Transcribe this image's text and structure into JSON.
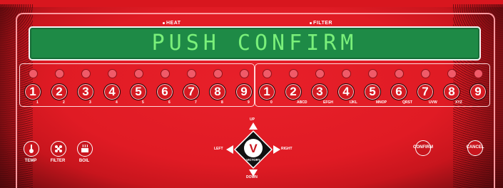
{
  "indicators": {
    "heat": "HEAT",
    "filter": "FILTER"
  },
  "display": {
    "text": "PUSH CONFIRM"
  },
  "left_keys": [
    {
      "num": "1",
      "sub": "1"
    },
    {
      "num": "2",
      "sub": "2"
    },
    {
      "num": "3",
      "sub": "3"
    },
    {
      "num": "4",
      "sub": "4"
    },
    {
      "num": "5",
      "sub": "5"
    },
    {
      "num": "6",
      "sub": "6"
    },
    {
      "num": "7",
      "sub": "7"
    },
    {
      "num": "8",
      "sub": "8"
    },
    {
      "num": "9",
      "sub": "9"
    }
  ],
  "right_keys": [
    {
      "num": "1",
      "sub": "0"
    },
    {
      "num": "2",
      "sub": "ABCD"
    },
    {
      "num": "3",
      "sub": "EFGH"
    },
    {
      "num": "4",
      "sub": "IJKL"
    },
    {
      "num": "5",
      "sub": "MNOP"
    },
    {
      "num": "6",
      "sub": "QRST"
    },
    {
      "num": "7",
      "sub": "UVW"
    },
    {
      "num": "8",
      "sub": "XYZ"
    },
    {
      "num": "9",
      "sub": ""
    }
  ],
  "function_buttons": [
    {
      "label": "TEMP",
      "icon": "thermometer-icon"
    },
    {
      "label": "FILTER",
      "icon": "filter-icon"
    },
    {
      "label": "BOIL",
      "icon": "boil-icon"
    }
  ],
  "dpad": {
    "up": "UP",
    "down": "DOWN",
    "left": "LEFT",
    "right": "RIGHT",
    "logo_letter": "V",
    "logo_text": "VICTORY"
  },
  "actions": {
    "confirm": "CONFIRM",
    "cancel": "CANCEL"
  },
  "colors": {
    "panel": "#e01b24",
    "display": "#1e8a46",
    "display_text": "#7af07a",
    "led": "#f05a68"
  }
}
